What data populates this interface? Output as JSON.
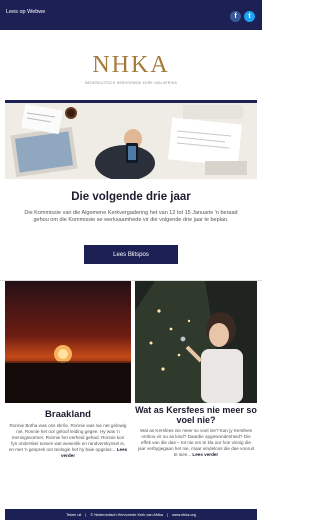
{
  "header": {
    "view_link": "Lees op Webwe",
    "social": [
      {
        "icon": "facebook-icon",
        "glyph": "f"
      },
      {
        "icon": "twitter-icon",
        "glyph": "t"
      }
    ]
  },
  "logo": {
    "text": "NHKA",
    "tagline": "NEDERDUITSCH HERVORMDE KERK VAN AFRIKA"
  },
  "main": {
    "title": "Die volgende drie jaar",
    "intro": "Die Kommissie van die Algemene Kerkvergadering het van 12 tot 15 Januarie 'n beraad gehou om die Kommissie se werksaamhede vir die volgende drie jaar te beplan.",
    "button_label": "Lees Blitspos"
  },
  "articles": [
    {
      "title": "Braakland",
      "text": "Ronnie Botha was ons skrôe. Ronnie was nie net gelowig nie, Ronnie het oor geloof leiding gegee. Hy was 'n meningsvormer. Ronnie het eerheid gehad. Ronnie kon fyn onderskei tussen wat wesenlik en randverskynsel is, en met 'n gesprek oor teologie het hy baie opgelos...",
      "more": "Lees verder"
    },
    {
      "title": "Wat as Kersfees nie meer so voel nie?",
      "text": "Wat as Kersfees nie meer so voel nie? Kan jy Kersfees onthou vir ou as kind? Daardie opgewondenheid? Die effek van die dae – tot nie om te kla oor hoe vinnig die jaar verbygegaan het nie, maar eindeloos die dae vooruit te sien...",
      "more": "Lees verder"
    }
  ],
  "footer": {
    "items": [
      "Teken uit",
      "© Nederduitsch Hervormde Kerk van Afrika",
      "www.nhka.org"
    ],
    "separator": "|"
  }
}
